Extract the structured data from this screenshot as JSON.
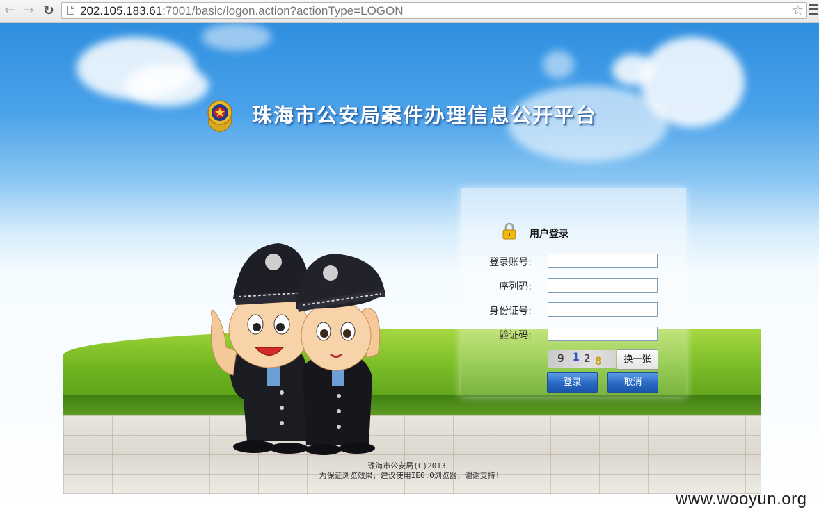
{
  "browser": {
    "url_host": "202.105.183.61",
    "url_rest": ":7001/basic/logon.action?actionType=LOGON"
  },
  "header": {
    "title": "珠海市公安局案件办理信息公开平台"
  },
  "login": {
    "title": "用户登录",
    "fields": [
      {
        "label": "登录账号:",
        "value": ""
      },
      {
        "label": "序列码:",
        "value": ""
      },
      {
        "label": "身份证号:",
        "value": ""
      },
      {
        "label": "验证码:",
        "value": ""
      }
    ],
    "captcha_text": [
      "9",
      "1",
      "2",
      "8"
    ],
    "refresh_label": "换一张",
    "submit_label": "登录",
    "cancel_label": "取消"
  },
  "footer": {
    "copyright": "珠海市公安局(C)2013",
    "notice": "为保证浏览效果，建议使用IE6.0浏览器，谢谢支持!"
  },
  "watermark": "www.wooyun.org",
  "colors": {
    "sky_top": "#2f8fe0",
    "button_blue": "#2b6cc6",
    "grass": "#6fb420"
  },
  "icons": [
    "back-arrow-icon",
    "forward-arrow-icon",
    "reload-icon",
    "page-icon",
    "bookmark-star-icon",
    "menu-icon",
    "police-emblem",
    "lock-icon"
  ]
}
